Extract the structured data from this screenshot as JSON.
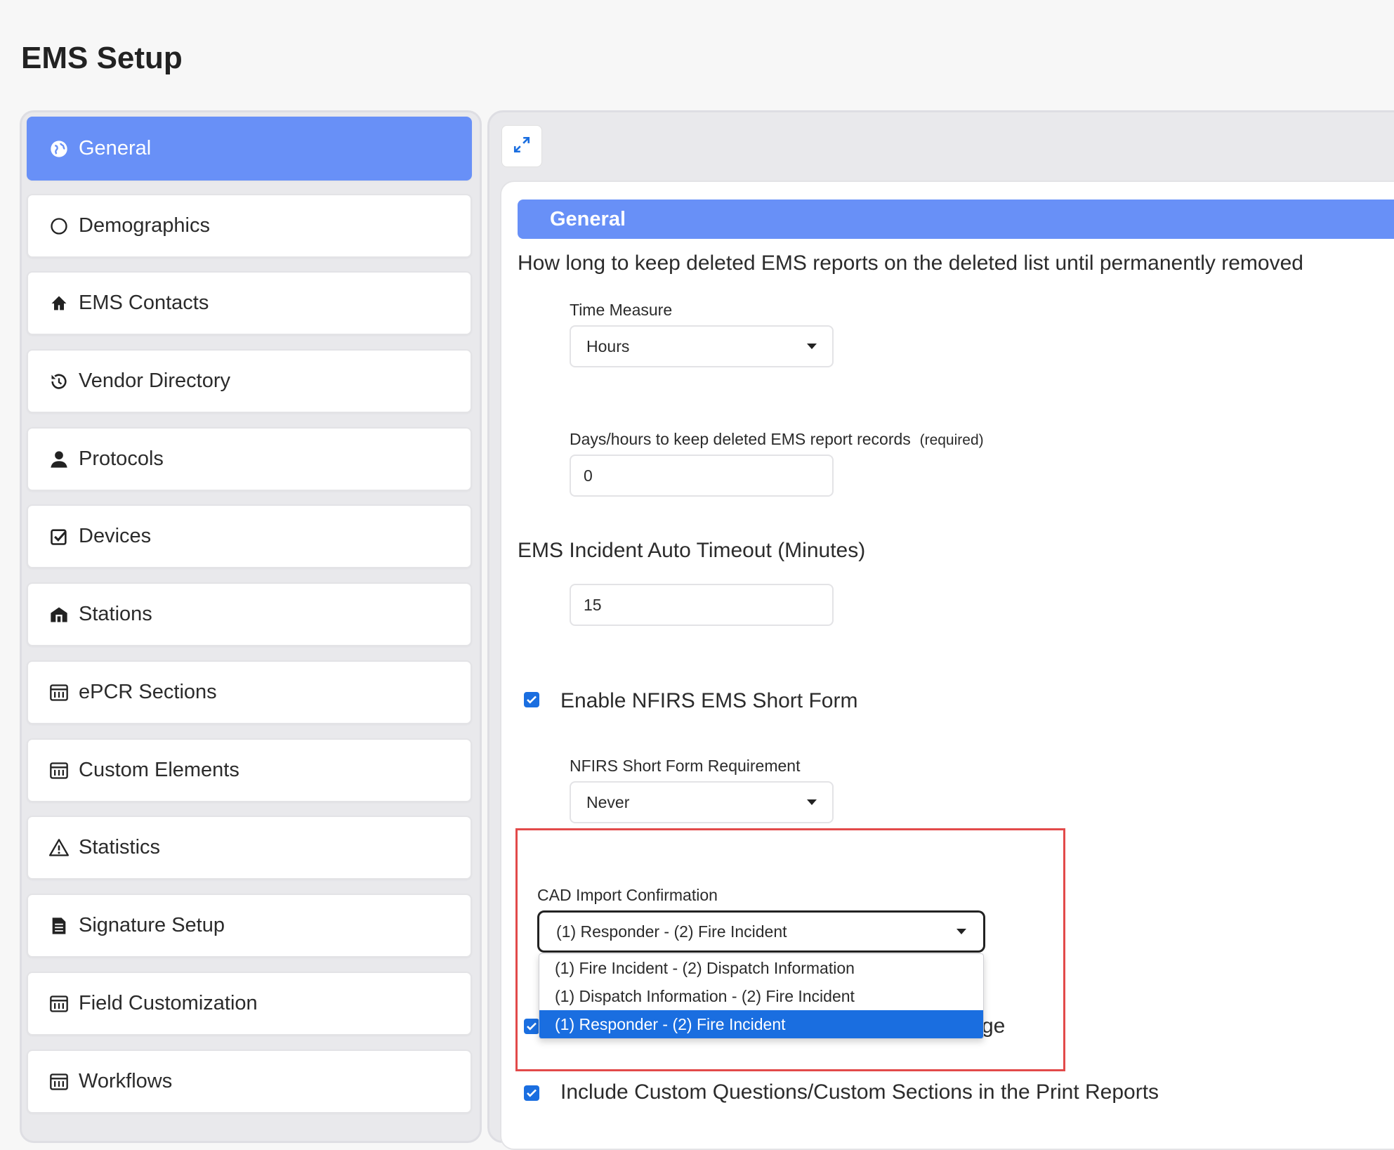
{
  "page": {
    "title": "EMS Setup"
  },
  "sidebar": {
    "items": [
      {
        "label": "General",
        "icon": "globe-icon",
        "active": true
      },
      {
        "label": "Demographics",
        "icon": "circle-icon"
      },
      {
        "label": "EMS Contacts",
        "icon": "home-icon"
      },
      {
        "label": "Vendor Directory",
        "icon": "history-icon"
      },
      {
        "label": "Protocols",
        "icon": "user-icon"
      },
      {
        "label": "Devices",
        "icon": "check-square-icon"
      },
      {
        "label": "Stations",
        "icon": "building-icon"
      },
      {
        "label": "ePCR Sections",
        "icon": "sliders-icon"
      },
      {
        "label": "Custom Elements",
        "icon": "sliders-icon"
      },
      {
        "label": "Statistics",
        "icon": "warning-icon"
      },
      {
        "label": "Signature Setup",
        "icon": "document-icon"
      },
      {
        "label": "Field Customization",
        "icon": "sliders-icon"
      },
      {
        "label": "Workflows",
        "icon": "sliders-icon"
      }
    ]
  },
  "main": {
    "section_title": "General",
    "retention_question": "How long to keep deleted EMS reports on the deleted list until permanently removed",
    "time_measure": {
      "label": "Time Measure",
      "value": "Hours"
    },
    "keep_days": {
      "label": "Days/hours to keep deleted EMS report records",
      "required": "(required)",
      "value": "0"
    },
    "auto_timeout": {
      "label": "EMS Incident Auto Timeout (Minutes)",
      "value": "15"
    },
    "nfirs_short_form": {
      "label": "Enable NFIRS EMS Short Form",
      "checked": true
    },
    "nfirs_requirement": {
      "label": "NFIRS Short Form Requirement",
      "value": "Never"
    },
    "cad_import": {
      "label": "CAD Import Confirmation",
      "value": "(1) Responder - (2) Fire Incident",
      "options": [
        "(1) Fire Incident - (2) Dispatch Information",
        "(1) Dispatch Information - (2) Fire Incident",
        "(1) Responder - (2) Fire Incident"
      ],
      "selected_index": 2
    },
    "hidden_option_tail": "ge",
    "custom_questions": {
      "label": "Include Custom Questions/Custom Sections in the Print Reports",
      "checked": true
    }
  },
  "colors": {
    "accent": "#6890f7",
    "selected": "#1a6ee0",
    "highlight": "#e24a4a"
  }
}
